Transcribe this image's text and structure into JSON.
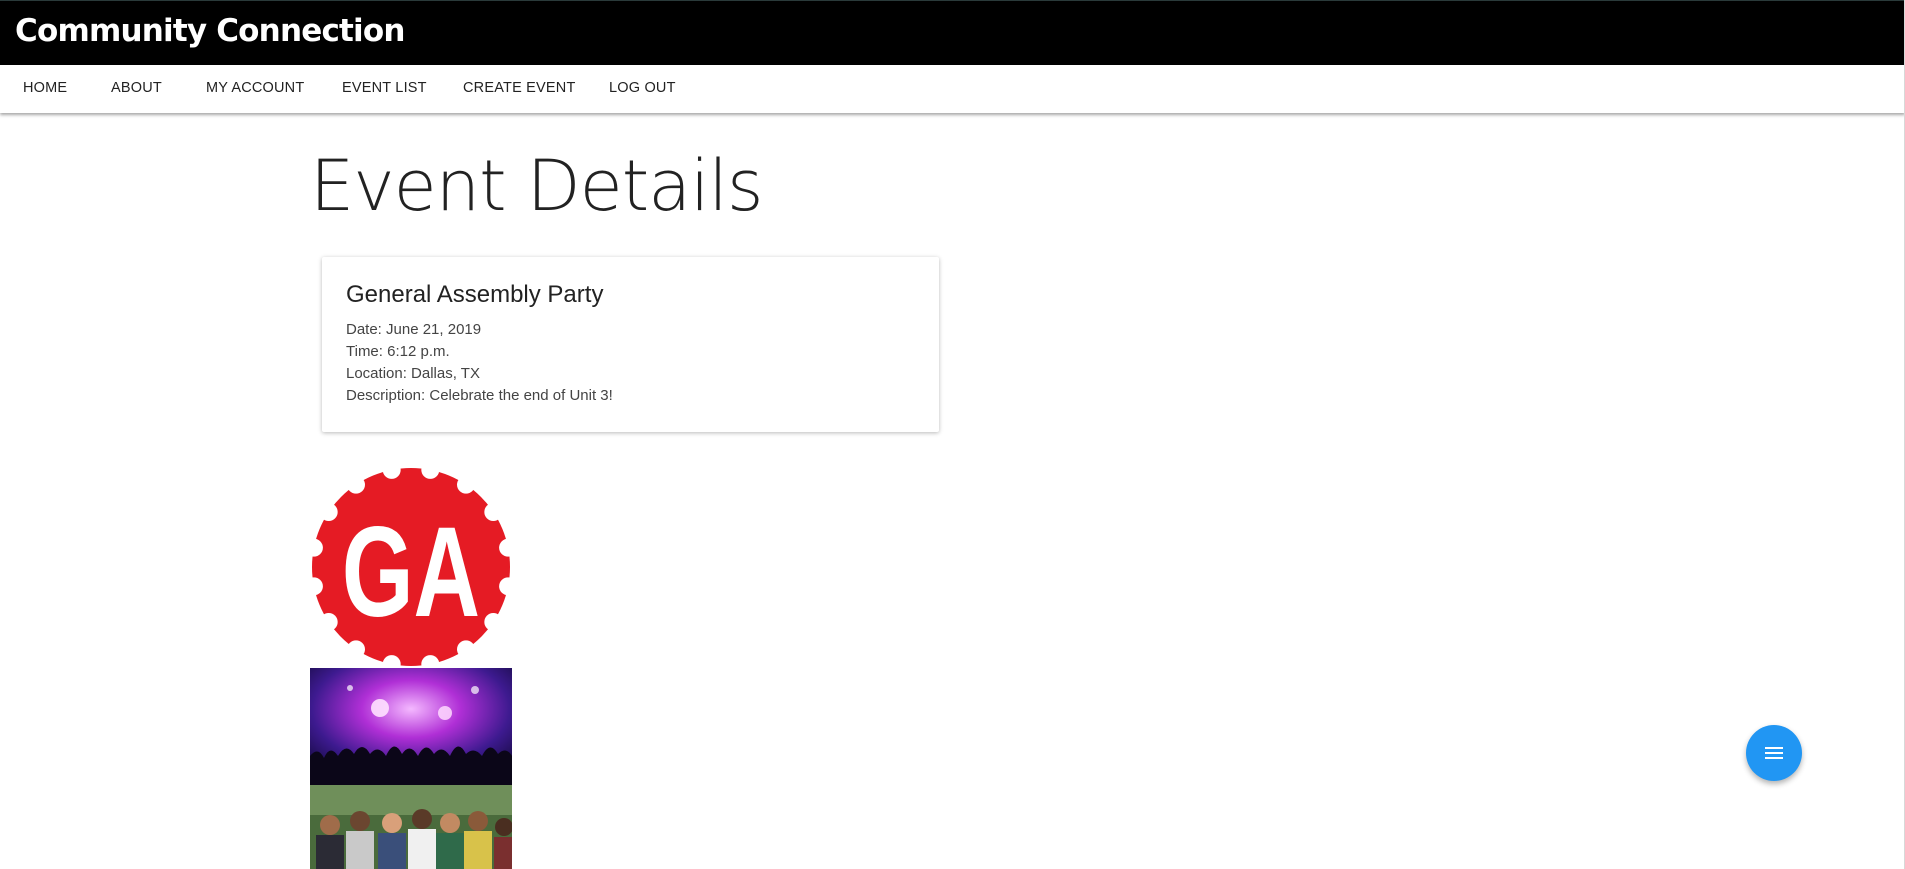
{
  "app": {
    "title": "Community Connection"
  },
  "nav": {
    "items": [
      {
        "label": "HOME"
      },
      {
        "label": "ABOUT"
      },
      {
        "label": "MY ACCOUNT"
      },
      {
        "label": "EVENT LIST"
      },
      {
        "label": "CREATE EVENT"
      },
      {
        "label": "LOG OUT"
      }
    ]
  },
  "page": {
    "title": "Event Details"
  },
  "event": {
    "name": "General Assembly Party",
    "date": "Date: June 21, 2019",
    "time": "Time: 6:12 p.m.",
    "location": "Location: Dallas, TX",
    "description": "Description: Celebrate the end of Unit 3!"
  },
  "images": {
    "logo": {
      "text": "GA",
      "color": "#e51b24",
      "icon": "ga-logo"
    },
    "party_photo": {
      "icon": "concert-crowd-photo"
    },
    "group_photo": {
      "icon": "group-people-photo"
    }
  },
  "fab": {
    "icon": "menu-icon",
    "color": "#2196f3"
  }
}
